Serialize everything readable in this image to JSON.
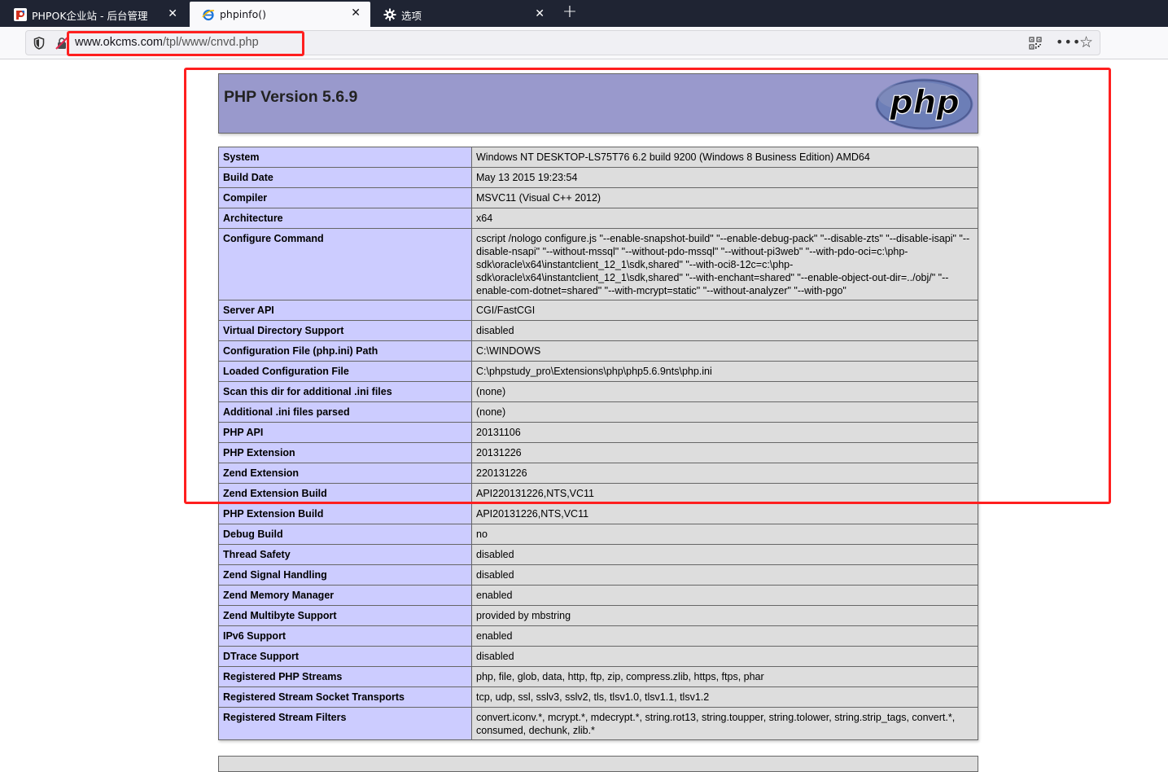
{
  "browser": {
    "tabs": [
      {
        "title": "PHPOK企业站 - 后台管理",
        "icon": "phpok-icon",
        "active": false
      },
      {
        "title": "phpinfo()",
        "icon": "ie-page-icon",
        "active": true
      },
      {
        "title": "选项",
        "icon": "gear-icon",
        "active": false
      }
    ],
    "new_tab_label": "+",
    "close_glyph": "✕",
    "url": {
      "host": "www.okcms.com",
      "path": "/tpl/www/cnvd.php"
    },
    "menu_glyph": "•••",
    "bookmark_glyph": "☆"
  },
  "phpinfo": {
    "title": "PHP Version 5.6.9",
    "logo_text": "php",
    "rows": [
      {
        "key": "System",
        "value": "Windows NT DESKTOP-LS75T76 6.2 build 9200 (Windows 8 Business Edition) AMD64"
      },
      {
        "key": "Build Date",
        "value": "May 13 2015 19:23:54"
      },
      {
        "key": "Compiler",
        "value": "MSVC11 (Visual C++ 2012)"
      },
      {
        "key": "Architecture",
        "value": "x64"
      },
      {
        "key": "Configure Command",
        "value": "cscript /nologo configure.js \"--enable-snapshot-build\" \"--enable-debug-pack\" \"--disable-zts\" \"--disable-isapi\" \"--disable-nsapi\" \"--without-mssql\" \"--without-pdo-mssql\" \"--without-pi3web\" \"--with-pdo-oci=c:\\php-sdk\\oracle\\x64\\instantclient_12_1\\sdk,shared\" \"--with-oci8-12c=c:\\php-sdk\\oracle\\x64\\instantclient_12_1\\sdk,shared\" \"--with-enchant=shared\" \"--enable-object-out-dir=../obj/\" \"--enable-com-dotnet=shared\" \"--with-mcrypt=static\" \"--without-analyzer\" \"--with-pgo\""
      },
      {
        "key": "Server API",
        "value": "CGI/FastCGI"
      },
      {
        "key": "Virtual Directory Support",
        "value": "disabled"
      },
      {
        "key": "Configuration File (php.ini) Path",
        "value": "C:\\WINDOWS"
      },
      {
        "key": "Loaded Configuration File",
        "value": "C:\\phpstudy_pro\\Extensions\\php\\php5.6.9nts\\php.ini"
      },
      {
        "key": "Scan this dir for additional .ini files",
        "value": "(none)"
      },
      {
        "key": "Additional .ini files parsed",
        "value": "(none)"
      },
      {
        "key": "PHP API",
        "value": "20131106"
      },
      {
        "key": "PHP Extension",
        "value": "20131226"
      },
      {
        "key": "Zend Extension",
        "value": "220131226"
      },
      {
        "key": "Zend Extension Build",
        "value": "API220131226,NTS,VC11"
      },
      {
        "key": "PHP Extension Build",
        "value": "API20131226,NTS,VC11"
      },
      {
        "key": "Debug Build",
        "value": "no"
      },
      {
        "key": "Thread Safety",
        "value": "disabled"
      },
      {
        "key": "Zend Signal Handling",
        "value": "disabled"
      },
      {
        "key": "Zend Memory Manager",
        "value": "enabled"
      },
      {
        "key": "Zend Multibyte Support",
        "value": "provided by mbstring"
      },
      {
        "key": "IPv6 Support",
        "value": "enabled"
      },
      {
        "key": "DTrace Support",
        "value": "disabled"
      },
      {
        "key": "Registered PHP Streams",
        "value": "php, file, glob, data, http, ftp, zip, compress.zlib, https, ftps, phar"
      },
      {
        "key": "Registered Stream Socket Transports",
        "value": "tcp, udp, ssl, sslv3, sslv2, tls, tlsv1.0, tlsv1.1, tlsv1.2"
      },
      {
        "key": "Registered Stream Filters",
        "value": "convert.iconv.*, mcrypt.*, mdecrypt.*, string.rot13, string.toupper, string.tolower, string.strip_tags, convert.*, consumed, dechunk, zlib.*"
      }
    ]
  },
  "colors": {
    "highlight": "#ff1f1f",
    "header_bg": "#9999cc",
    "key_bg": "#ccccff",
    "value_bg": "#dddddd"
  }
}
